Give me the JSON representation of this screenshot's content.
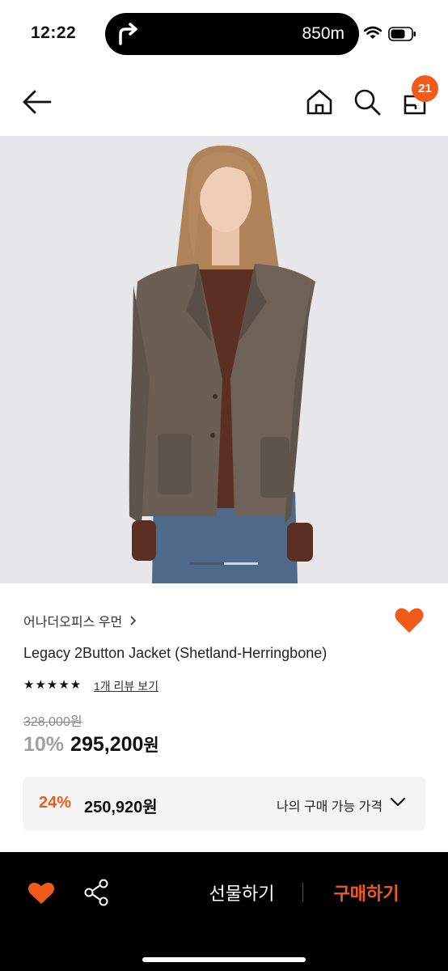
{
  "status_bar": {
    "time": "12:22",
    "nav_distance": "850m",
    "icons": [
      "turn-right-icon",
      "wifi-icon",
      "battery-icon"
    ]
  },
  "header": {
    "icons": [
      "back-arrow-icon",
      "home-icon",
      "search-icon",
      "cart-icon"
    ],
    "cart_badge": "21"
  },
  "product_image": {
    "page_position": 1,
    "page_count": 2
  },
  "product": {
    "brand": "어나더오피스 우먼",
    "name": "Legacy 2Button Jacket (Shetland-Herringbone)",
    "rating_stars": "★★★★★",
    "rating_value": 5,
    "review_link": "1개 리뷰 보기",
    "original_price": "328,000원",
    "discount_rate": "10%",
    "sale_price": "295,200",
    "sale_price_unit": "원",
    "liked": true
  },
  "my_price": {
    "rate": "24%",
    "price": "250,920원",
    "label": "나의 구매 가능 가격"
  },
  "bottom_bar": {
    "gift_label": "선물하기",
    "buy_label": "구매하기"
  },
  "colors": {
    "accent": "#f25a1a",
    "bottom_bar_bg": "#000000",
    "my_price_bg": "#f4f4f5"
  }
}
